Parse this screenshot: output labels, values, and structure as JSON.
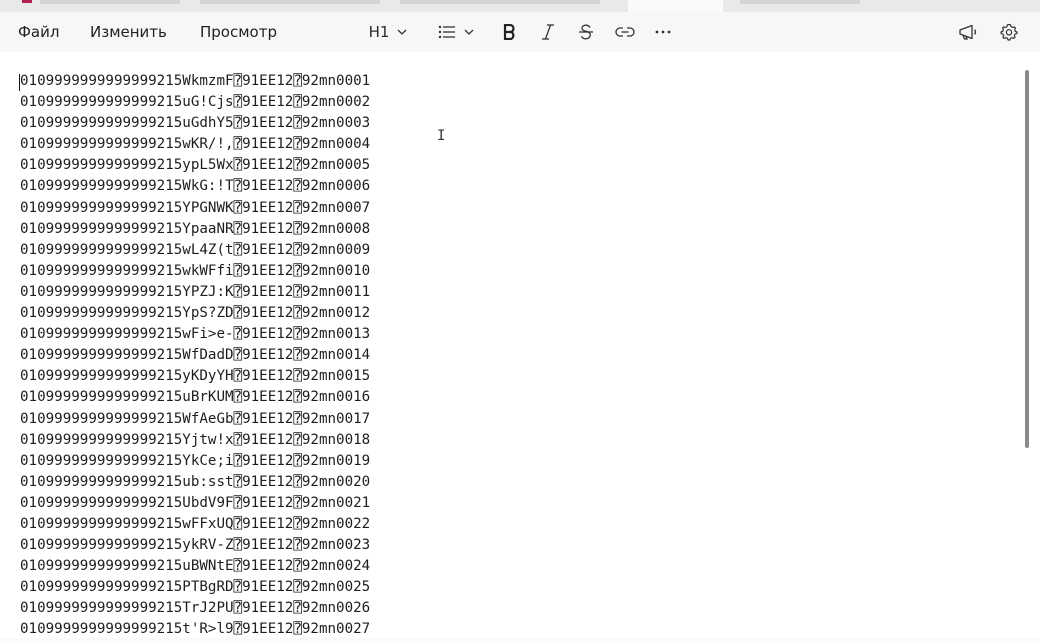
{
  "window": {
    "accent_color": "#b02050"
  },
  "menu": {
    "file": "Файл",
    "edit": "Изменить",
    "view": "Просмотр"
  },
  "toolbar": {
    "heading_label": "H1",
    "icons": [
      "chevron-down-icon",
      "list-icon",
      "bold-icon",
      "italic-icon",
      "strikethrough-icon",
      "link-icon",
      "more-icon",
      "megaphone-icon",
      "gear-icon"
    ]
  },
  "document": {
    "lines": [
      "0109999999999999215WkmzmF\u001d91EE12\u001d92mn0001",
      "0109999999999999215uG!Cjs\u001d91EE12\u001d92mn0002",
      "0109999999999999215uGdhY5\u001d91EE12\u001d92mn0003",
      "0109999999999999215wKR/!,\u001d91EE12\u001d92mn0004",
      "0109999999999999215ypL5Wx\u001d91EE12\u001d92mn0005",
      "0109999999999999215WkG:!T\u001d91EE12\u001d92mn0006",
      "0109999999999999215YPGNWK\u001d91EE12\u001d92mn0007",
      "0109999999999999215YpaaNR\u001d91EE12\u001d92mn0008",
      "0109999999999999215wL4Z(t\u001d91EE12\u001d92mn0009",
      "0109999999999999215wkWFfi\u001d91EE12\u001d92mn0010",
      "0109999999999999215YPZJ:K\u001d91EE12\u001d92mn0011",
      "0109999999999999215YpS?ZD\u001d91EE12\u001d92mn0012",
      "0109999999999999215wFi>e-\u001d91EE12\u001d92mn0013",
      "0109999999999999215WfDadD\u001d91EE12\u001d92mn0014",
      "0109999999999999215yKDyYH\u001d91EE12\u001d92mn0015",
      "0109999999999999215uBrKUM\u001d91EE12\u001d92mn0016",
      "0109999999999999215WfAeGb\u001d91EE12\u001d92mn0017",
      "0109999999999999215Yjtw!x\u001d91EE12\u001d92mn0018",
      "0109999999999999215YkCe;i\u001d91EE12\u001d92mn0019",
      "0109999999999999215ub:sst\u001d91EE12\u001d92mn0020",
      "0109999999999999215UbdV9F\u001d91EE12\u001d92mn0021",
      "0109999999999999215wFFxUQ\u001d91EE12\u001d92mn0022",
      "0109999999999999215ykRV-Z\u001d91EE12\u001d92mn0023",
      "0109999999999999215uBWNtE\u001d91EE12\u001d92mn0024",
      "0109999999999999215PTBgRD\u001d91EE12\u001d92mn0025",
      "0109999999999999215TrJ2PU\u001d91EE12\u001d92mn0026",
      "0109999999999999215t'R>l9\u001d91EE12\u001d92mn0027"
    ]
  }
}
